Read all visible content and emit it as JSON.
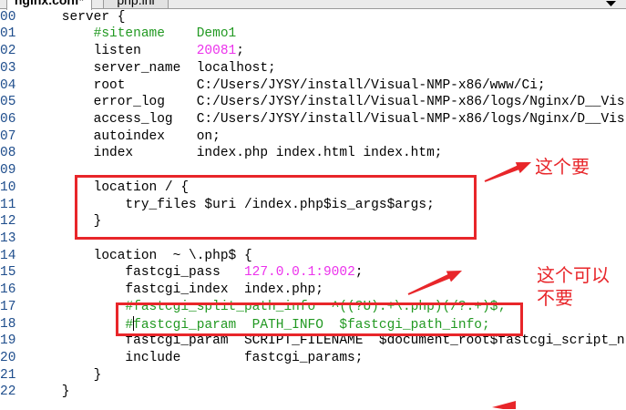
{
  "window": {
    "tabs": [
      {
        "label": "nginx.conf*",
        "active": true
      },
      {
        "label": "php.ini",
        "active": false
      }
    ],
    "tab_menu_icon": "chevron-down-icon"
  },
  "editor": {
    "lines": [
      {
        "num": "00",
        "tokens": [
          {
            "t": "    server {",
            "k": "plain"
          }
        ]
      },
      {
        "num": "01",
        "tokens": [
          {
            "t": "        #sitename    Demo1",
            "k": "comment"
          }
        ]
      },
      {
        "num": "02",
        "tokens": [
          {
            "t": "        listen       ",
            "k": "plain"
          },
          {
            "t": "20081",
            "k": "number"
          },
          {
            "t": ";",
            "k": "plain"
          }
        ]
      },
      {
        "num": "03",
        "tokens": [
          {
            "t": "        server_name  localhost;",
            "k": "plain"
          }
        ]
      },
      {
        "num": "04",
        "tokens": [
          {
            "t": "        root         C:/Users/JYSY/install/Visual-NMP-x86/www/Ci;",
            "k": "plain"
          }
        ]
      },
      {
        "num": "05",
        "tokens": [
          {
            "t": "        error_log    C:/Users/JYSY/install/Visual-NMP-x86/logs/Nginx/D__Vis",
            "k": "plain"
          }
        ]
      },
      {
        "num": "06",
        "tokens": [
          {
            "t": "        access_log   C:/Users/JYSY/install/Visual-NMP-x86/logs/Nginx/D__Vis",
            "k": "plain"
          }
        ]
      },
      {
        "num": "07",
        "tokens": [
          {
            "t": "        autoindex    on;",
            "k": "plain"
          }
        ]
      },
      {
        "num": "08",
        "tokens": [
          {
            "t": "        index        index.php index.html index.htm;",
            "k": "plain"
          }
        ]
      },
      {
        "num": "09",
        "tokens": []
      },
      {
        "num": "10",
        "tokens": [
          {
            "t": "        location / {",
            "k": "plain"
          }
        ]
      },
      {
        "num": "11",
        "tokens": [
          {
            "t": "            try_files $uri /index.php$is_args$args;",
            "k": "plain"
          }
        ]
      },
      {
        "num": "12",
        "tokens": [
          {
            "t": "        }",
            "k": "plain"
          }
        ]
      },
      {
        "num": "13",
        "tokens": []
      },
      {
        "num": "14",
        "tokens": [
          {
            "t": "        location  ~ \\.php$ {",
            "k": "plain"
          }
        ]
      },
      {
        "num": "15",
        "tokens": [
          {
            "t": "            fastcgi_pass   ",
            "k": "plain"
          },
          {
            "t": "127.0.0.1:9002",
            "k": "number"
          },
          {
            "t": ";",
            "k": "plain"
          }
        ]
      },
      {
        "num": "16",
        "tokens": [
          {
            "t": "            fastcgi_index  index.php;",
            "k": "plain"
          }
        ]
      },
      {
        "num": "17",
        "tokens": [
          {
            "t": "            #fastcgi_split_path_info  ^((?U).+\\.php)(/?.+)$;",
            "k": "comment"
          }
        ]
      },
      {
        "num": "18",
        "tokens": [
          {
            "t": "            #",
            "k": "comment"
          },
          {
            "k": "caret"
          },
          {
            "t": "fastcgi_param  PATH_INFO  $fastcgi_path_info;",
            "k": "comment"
          }
        ]
      },
      {
        "num": "19",
        "tokens": [
          {
            "t": "            fastcgi_param  SCRIPT_FILENAME  $document_root$fastcgi_script_n",
            "k": "plain"
          }
        ]
      },
      {
        "num": "20",
        "tokens": [
          {
            "t": "            include        fastcgi_params;",
            "k": "plain"
          }
        ]
      },
      {
        "num": "21",
        "tokens": [
          {
            "t": "        }",
            "k": "plain"
          }
        ]
      },
      {
        "num": "22",
        "tokens": [
          {
            "t": "    }",
            "k": "plain"
          }
        ]
      }
    ]
  },
  "annotations": {
    "note_keep": "这个要",
    "note_optional": [
      "这个可以",
      "不要"
    ]
  },
  "colors": {
    "text": "#000000",
    "comment": "#229922",
    "number": "#ec32ec",
    "line_number": "#1e4d8c",
    "annotation": "#e8262a"
  }
}
